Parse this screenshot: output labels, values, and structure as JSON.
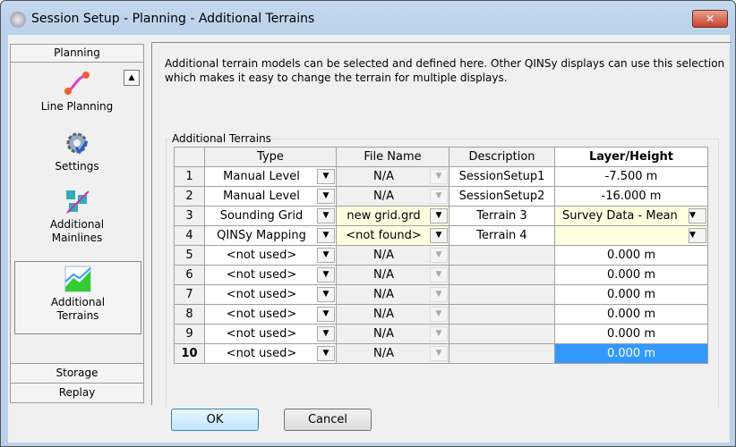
{
  "window": {
    "title": "Session Setup - Planning -  Additional Terrains",
    "close": "✕"
  },
  "nav": {
    "header": "Planning",
    "items": [
      {
        "label": "Line Planning"
      },
      {
        "label": "Settings"
      },
      {
        "label": "Additional Mainlines"
      },
      {
        "label": "Additional Terrains"
      }
    ],
    "footer": [
      "Storage",
      "Replay"
    ]
  },
  "description": "Additional terrain models can be selected and defined here.  Other QINSy displays can use this selection which makes it easy to change the terrain for multiple displays.",
  "group_label": "Additional Terrains",
  "columns": [
    "Type",
    "File Name",
    "Description",
    "Layer/Height"
  ],
  "rows": [
    {
      "n": "1",
      "type": "Manual Level",
      "file": "N/A",
      "desc": "SessionSetup1",
      "layer": "-7.500 m"
    },
    {
      "n": "2",
      "type": "Manual Level",
      "file": "N/A",
      "desc": "SessionSetup2",
      "layer": "-16.000 m"
    },
    {
      "n": "3",
      "type": "Sounding Grid",
      "file": "new grid.grd",
      "desc": "Terrain 3",
      "layer": "Survey Data - Mean"
    },
    {
      "n": "4",
      "type": "QINSy Mapping",
      "file": "<not found>",
      "desc": "Terrain 4",
      "layer": ""
    },
    {
      "n": "5",
      "type": "<not used>",
      "file": "N/A",
      "desc": "",
      "layer": "0.000 m"
    },
    {
      "n": "6",
      "type": "<not used>",
      "file": "N/A",
      "desc": "",
      "layer": "0.000 m"
    },
    {
      "n": "7",
      "type": "<not used>",
      "file": "N/A",
      "desc": "",
      "layer": "0.000 m"
    },
    {
      "n": "8",
      "type": "<not used>",
      "file": "N/A",
      "desc": "",
      "layer": "0.000 m"
    },
    {
      "n": "9",
      "type": "<not used>",
      "file": "N/A",
      "desc": "",
      "layer": "0.000 m"
    },
    {
      "n": "10",
      "type": "<not used>",
      "file": "N/A",
      "desc": "",
      "layer": "0.000 m"
    }
  ],
  "buttons": {
    "ok": "OK",
    "cancel": "Cancel"
  }
}
